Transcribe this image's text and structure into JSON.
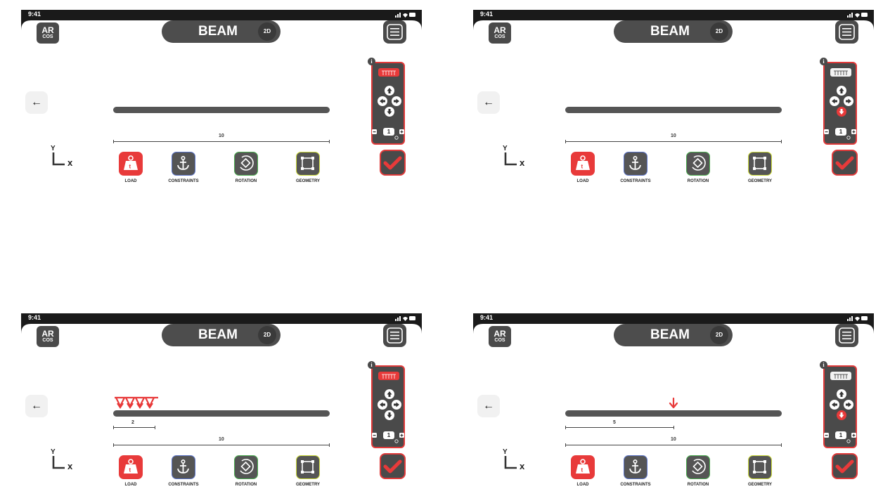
{
  "app": {
    "time": "9:41",
    "logo_top": "AR",
    "logo_bottom": "COS",
    "title": "BEAM",
    "mode_badge": "2D",
    "back_label": "←",
    "info_label": "i"
  },
  "axes": {
    "y_label": "Y",
    "x_label": "x"
  },
  "tools": [
    {
      "id": "load",
      "label": "LOAD",
      "color": "#e83a3a"
    },
    {
      "id": "constraints",
      "label": "CONSTRAINTS",
      "color": "#3d5f9a"
    },
    {
      "id": "rotation",
      "label": "ROTATION",
      "color": "#3a9a4a"
    },
    {
      "id": "geometry",
      "label": "GEOMETRY",
      "color": "#b8b83a"
    }
  ],
  "colors": {
    "accent": "#e03a3a",
    "dark": "#4a4a4a",
    "beam": "#555555"
  },
  "screens": [
    {
      "beam_length_label": "10",
      "selected_load_type": "distributed",
      "highlighted_arrow": "none",
      "load_length_label": "",
      "load_position_label": "",
      "stepper_value": "1"
    },
    {
      "beam_length_label": "10",
      "selected_load_type": "none",
      "highlighted_arrow": "down",
      "load_length_label": "",
      "load_position_label": "",
      "stepper_value": "1"
    },
    {
      "beam_length_label": "10",
      "selected_load_type": "distributed",
      "highlighted_arrow": "none",
      "load_length_label": "2",
      "load_position_label": "",
      "stepper_value": "1"
    },
    {
      "beam_length_label": "10",
      "selected_load_type": "none",
      "highlighted_arrow": "down",
      "load_length_label": "",
      "load_position_label": "5",
      "stepper_value": "1"
    }
  ]
}
